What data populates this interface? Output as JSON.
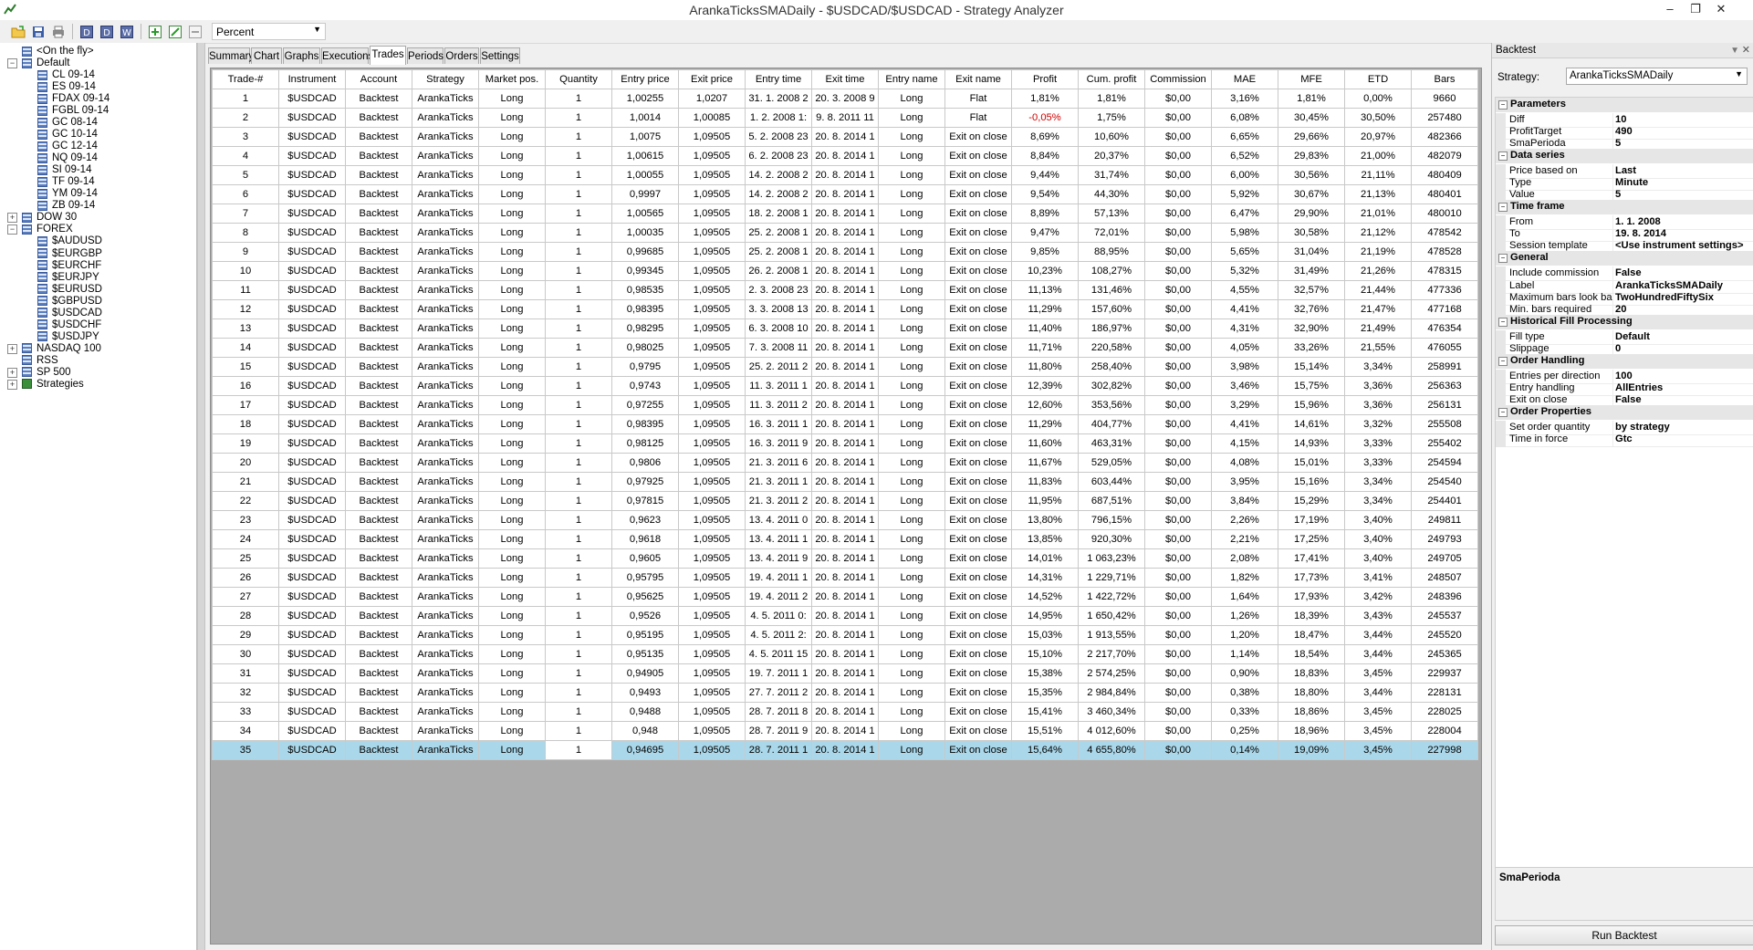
{
  "window": {
    "title": "ArankaTicksSMADaily - $USDCAD/$USDCAD - Strategy Analyzer"
  },
  "toolbar": {
    "display_mode": "Percent"
  },
  "tree": [
    {
      "label": "<On the fly>",
      "level": 1,
      "expander": "",
      "icon": "grid"
    },
    {
      "label": "Default",
      "level": 0,
      "expander": "−",
      "icon": "grid"
    },
    {
      "label": "CL 09-14",
      "level": 1,
      "expander": "",
      "icon": "instr"
    },
    {
      "label": "ES 09-14",
      "level": 1,
      "expander": "",
      "icon": "instr"
    },
    {
      "label": "FDAX 09-14",
      "level": 1,
      "expander": "",
      "icon": "instr"
    },
    {
      "label": "FGBL 09-14",
      "level": 1,
      "expander": "",
      "icon": "instr"
    },
    {
      "label": "GC 08-14",
      "level": 1,
      "expander": "",
      "icon": "instr"
    },
    {
      "label": "GC 10-14",
      "level": 1,
      "expander": "",
      "icon": "instr"
    },
    {
      "label": "GC 12-14",
      "level": 1,
      "expander": "",
      "icon": "instr"
    },
    {
      "label": "NQ 09-14",
      "level": 1,
      "expander": "",
      "icon": "instr"
    },
    {
      "label": "SI 09-14",
      "level": 1,
      "expander": "",
      "icon": "instr"
    },
    {
      "label": "TF 09-14",
      "level": 1,
      "expander": "",
      "icon": "instr"
    },
    {
      "label": "YM 09-14",
      "level": 1,
      "expander": "",
      "icon": "instr"
    },
    {
      "label": "ZB 09-14",
      "level": 1,
      "expander": "",
      "icon": "instr"
    },
    {
      "label": "DOW 30",
      "level": 0,
      "expander": "+",
      "icon": "grid"
    },
    {
      "label": "FOREX",
      "level": 0,
      "expander": "−",
      "icon": "grid"
    },
    {
      "label": "$AUDUSD",
      "level": 1,
      "expander": "",
      "icon": "instr"
    },
    {
      "label": "$EURGBP",
      "level": 1,
      "expander": "",
      "icon": "instr"
    },
    {
      "label": "$EURCHF",
      "level": 1,
      "expander": "",
      "icon": "instr"
    },
    {
      "label": "$EURJPY",
      "level": 1,
      "expander": "",
      "icon": "instr"
    },
    {
      "label": "$EURUSD",
      "level": 1,
      "expander": "",
      "icon": "instr"
    },
    {
      "label": "$GBPUSD",
      "level": 1,
      "expander": "",
      "icon": "instr"
    },
    {
      "label": "$USDCAD",
      "level": 1,
      "expander": "",
      "icon": "instr"
    },
    {
      "label": "$USDCHF",
      "level": 1,
      "expander": "",
      "icon": "instr"
    },
    {
      "label": "$USDJPY",
      "level": 1,
      "expander": "",
      "icon": "instr"
    },
    {
      "label": "NASDAQ 100",
      "level": 0,
      "expander": "+",
      "icon": "grid"
    },
    {
      "label": "RSS",
      "level": 0,
      "expander": "",
      "icon": "grid"
    },
    {
      "label": "SP 500",
      "level": 0,
      "expander": "+",
      "icon": "grid"
    },
    {
      "label": "Strategies",
      "level": 0,
      "expander": "+",
      "icon": "strat"
    }
  ],
  "tabs": [
    "Summary",
    "Chart",
    "Graphs",
    "Executions",
    "Trades",
    "Periods",
    "Orders",
    "Settings"
  ],
  "active_tab": "Trades",
  "trades": {
    "columns": [
      "Trade-#",
      "Instrument",
      "Account",
      "Strategy",
      "Market pos.",
      "Quantity",
      "Entry price",
      "Exit price",
      "Entry time",
      "Exit time",
      "Entry name",
      "Exit name",
      "Profit",
      "Cum. profit",
      "Commission",
      "MAE",
      "MFE",
      "ETD",
      "Bars"
    ],
    "rows": [
      [
        "1",
        "$USDCAD",
        "Backtest",
        "ArankaTicks",
        "Long",
        "1",
        "1,00255",
        "1,0207",
        "31. 1. 2008 2",
        "20. 3. 2008 9",
        "Long",
        "Flat",
        "1,81%",
        "1,81%",
        "$0,00",
        "3,16%",
        "1,81%",
        "0,00%",
        "9660"
      ],
      [
        "2",
        "$USDCAD",
        "Backtest",
        "ArankaTicks",
        "Long",
        "1",
        "1,0014",
        "1,00085",
        "1. 2. 2008 1:",
        "9. 8. 2011 11",
        "Long",
        "Flat",
        "-0,05%",
        "1,75%",
        "$0,00",
        "6,08%",
        "30,45%",
        "30,50%",
        "257480"
      ],
      [
        "3",
        "$USDCAD",
        "Backtest",
        "ArankaTicks",
        "Long",
        "1",
        "1,0075",
        "1,09505",
        "5. 2. 2008 23",
        "20. 8. 2014 1",
        "Long",
        "Exit on close",
        "8,69%",
        "10,60%",
        "$0,00",
        "6,65%",
        "29,66%",
        "20,97%",
        "482366"
      ],
      [
        "4",
        "$USDCAD",
        "Backtest",
        "ArankaTicks",
        "Long",
        "1",
        "1,00615",
        "1,09505",
        "6. 2. 2008 23",
        "20. 8. 2014 1",
        "Long",
        "Exit on close",
        "8,84%",
        "20,37%",
        "$0,00",
        "6,52%",
        "29,83%",
        "21,00%",
        "482079"
      ],
      [
        "5",
        "$USDCAD",
        "Backtest",
        "ArankaTicks",
        "Long",
        "1",
        "1,00055",
        "1,09505",
        "14. 2. 2008 2",
        "20. 8. 2014 1",
        "Long",
        "Exit on close",
        "9,44%",
        "31,74%",
        "$0,00",
        "6,00%",
        "30,56%",
        "21,11%",
        "480409"
      ],
      [
        "6",
        "$USDCAD",
        "Backtest",
        "ArankaTicks",
        "Long",
        "1",
        "0,9997",
        "1,09505",
        "14. 2. 2008 2",
        "20. 8. 2014 1",
        "Long",
        "Exit on close",
        "9,54%",
        "44,30%",
        "$0,00",
        "5,92%",
        "30,67%",
        "21,13%",
        "480401"
      ],
      [
        "7",
        "$USDCAD",
        "Backtest",
        "ArankaTicks",
        "Long",
        "1",
        "1,00565",
        "1,09505",
        "18. 2. 2008 1",
        "20. 8. 2014 1",
        "Long",
        "Exit on close",
        "8,89%",
        "57,13%",
        "$0,00",
        "6,47%",
        "29,90%",
        "21,01%",
        "480010"
      ],
      [
        "8",
        "$USDCAD",
        "Backtest",
        "ArankaTicks",
        "Long",
        "1",
        "1,00035",
        "1,09505",
        "25. 2. 2008 1",
        "20. 8. 2014 1",
        "Long",
        "Exit on close",
        "9,47%",
        "72,01%",
        "$0,00",
        "5,98%",
        "30,58%",
        "21,12%",
        "478542"
      ],
      [
        "9",
        "$USDCAD",
        "Backtest",
        "ArankaTicks",
        "Long",
        "1",
        "0,99685",
        "1,09505",
        "25. 2. 2008 1",
        "20. 8. 2014 1",
        "Long",
        "Exit on close",
        "9,85%",
        "88,95%",
        "$0,00",
        "5,65%",
        "31,04%",
        "21,19%",
        "478528"
      ],
      [
        "10",
        "$USDCAD",
        "Backtest",
        "ArankaTicks",
        "Long",
        "1",
        "0,99345",
        "1,09505",
        "26. 2. 2008 1",
        "20. 8. 2014 1",
        "Long",
        "Exit on close",
        "10,23%",
        "108,27%",
        "$0,00",
        "5,32%",
        "31,49%",
        "21,26%",
        "478315"
      ],
      [
        "11",
        "$USDCAD",
        "Backtest",
        "ArankaTicks",
        "Long",
        "1",
        "0,98535",
        "1,09505",
        "2. 3. 2008 23",
        "20. 8. 2014 1",
        "Long",
        "Exit on close",
        "11,13%",
        "131,46%",
        "$0,00",
        "4,55%",
        "32,57%",
        "21,44%",
        "477336"
      ],
      [
        "12",
        "$USDCAD",
        "Backtest",
        "ArankaTicks",
        "Long",
        "1",
        "0,98395",
        "1,09505",
        "3. 3. 2008 13",
        "20. 8. 2014 1",
        "Long",
        "Exit on close",
        "11,29%",
        "157,60%",
        "$0,00",
        "4,41%",
        "32,76%",
        "21,47%",
        "477168"
      ],
      [
        "13",
        "$USDCAD",
        "Backtest",
        "ArankaTicks",
        "Long",
        "1",
        "0,98295",
        "1,09505",
        "6. 3. 2008 10",
        "20. 8. 2014 1",
        "Long",
        "Exit on close",
        "11,40%",
        "186,97%",
        "$0,00",
        "4,31%",
        "32,90%",
        "21,49%",
        "476354"
      ],
      [
        "14",
        "$USDCAD",
        "Backtest",
        "ArankaTicks",
        "Long",
        "1",
        "0,98025",
        "1,09505",
        "7. 3. 2008 11",
        "20. 8. 2014 1",
        "Long",
        "Exit on close",
        "11,71%",
        "220,58%",
        "$0,00",
        "4,05%",
        "33,26%",
        "21,55%",
        "476055"
      ],
      [
        "15",
        "$USDCAD",
        "Backtest",
        "ArankaTicks",
        "Long",
        "1",
        "0,9795",
        "1,09505",
        "25. 2. 2011 2",
        "20. 8. 2014 1",
        "Long",
        "Exit on close",
        "11,80%",
        "258,40%",
        "$0,00",
        "3,98%",
        "15,14%",
        "3,34%",
        "258991"
      ],
      [
        "16",
        "$USDCAD",
        "Backtest",
        "ArankaTicks",
        "Long",
        "1",
        "0,9743",
        "1,09505",
        "11. 3. 2011 1",
        "20. 8. 2014 1",
        "Long",
        "Exit on close",
        "12,39%",
        "302,82%",
        "$0,00",
        "3,46%",
        "15,75%",
        "3,36%",
        "256363"
      ],
      [
        "17",
        "$USDCAD",
        "Backtest",
        "ArankaTicks",
        "Long",
        "1",
        "0,97255",
        "1,09505",
        "11. 3. 2011 2",
        "20. 8. 2014 1",
        "Long",
        "Exit on close",
        "12,60%",
        "353,56%",
        "$0,00",
        "3,29%",
        "15,96%",
        "3,36%",
        "256131"
      ],
      [
        "18",
        "$USDCAD",
        "Backtest",
        "ArankaTicks",
        "Long",
        "1",
        "0,98395",
        "1,09505",
        "16. 3. 2011 1",
        "20. 8. 2014 1",
        "Long",
        "Exit on close",
        "11,29%",
        "404,77%",
        "$0,00",
        "4,41%",
        "14,61%",
        "3,32%",
        "255508"
      ],
      [
        "19",
        "$USDCAD",
        "Backtest",
        "ArankaTicks",
        "Long",
        "1",
        "0,98125",
        "1,09505",
        "16. 3. 2011 9",
        "20. 8. 2014 1",
        "Long",
        "Exit on close",
        "11,60%",
        "463,31%",
        "$0,00",
        "4,15%",
        "14,93%",
        "3,33%",
        "255402"
      ],
      [
        "20",
        "$USDCAD",
        "Backtest",
        "ArankaTicks",
        "Long",
        "1",
        "0,9806",
        "1,09505",
        "21. 3. 2011 6",
        "20. 8. 2014 1",
        "Long",
        "Exit on close",
        "11,67%",
        "529,05%",
        "$0,00",
        "4,08%",
        "15,01%",
        "3,33%",
        "254594"
      ],
      [
        "21",
        "$USDCAD",
        "Backtest",
        "ArankaTicks",
        "Long",
        "1",
        "0,97925",
        "1,09505",
        "21. 3. 2011 1",
        "20. 8. 2014 1",
        "Long",
        "Exit on close",
        "11,83%",
        "603,44%",
        "$0,00",
        "3,95%",
        "15,16%",
        "3,34%",
        "254540"
      ],
      [
        "22",
        "$USDCAD",
        "Backtest",
        "ArankaTicks",
        "Long",
        "1",
        "0,97815",
        "1,09505",
        "21. 3. 2011 2",
        "20. 8. 2014 1",
        "Long",
        "Exit on close",
        "11,95%",
        "687,51%",
        "$0,00",
        "3,84%",
        "15,29%",
        "3,34%",
        "254401"
      ],
      [
        "23",
        "$USDCAD",
        "Backtest",
        "ArankaTicks",
        "Long",
        "1",
        "0,9623",
        "1,09505",
        "13. 4. 2011 0",
        "20. 8. 2014 1",
        "Long",
        "Exit on close",
        "13,80%",
        "796,15%",
        "$0,00",
        "2,26%",
        "17,19%",
        "3,40%",
        "249811"
      ],
      [
        "24",
        "$USDCAD",
        "Backtest",
        "ArankaTicks",
        "Long",
        "1",
        "0,9618",
        "1,09505",
        "13. 4. 2011 1",
        "20. 8. 2014 1",
        "Long",
        "Exit on close",
        "13,85%",
        "920,30%",
        "$0,00",
        "2,21%",
        "17,25%",
        "3,40%",
        "249793"
      ],
      [
        "25",
        "$USDCAD",
        "Backtest",
        "ArankaTicks",
        "Long",
        "1",
        "0,9605",
        "1,09505",
        "13. 4. 2011 9",
        "20. 8. 2014 1",
        "Long",
        "Exit on close",
        "14,01%",
        "1 063,23%",
        "$0,00",
        "2,08%",
        "17,41%",
        "3,40%",
        "249705"
      ],
      [
        "26",
        "$USDCAD",
        "Backtest",
        "ArankaTicks",
        "Long",
        "1",
        "0,95795",
        "1,09505",
        "19. 4. 2011 1",
        "20. 8. 2014 1",
        "Long",
        "Exit on close",
        "14,31%",
        "1 229,71%",
        "$0,00",
        "1,82%",
        "17,73%",
        "3,41%",
        "248507"
      ],
      [
        "27",
        "$USDCAD",
        "Backtest",
        "ArankaTicks",
        "Long",
        "1",
        "0,95625",
        "1,09505",
        "19. 4. 2011 2",
        "20. 8. 2014 1",
        "Long",
        "Exit on close",
        "14,52%",
        "1 422,72%",
        "$0,00",
        "1,64%",
        "17,93%",
        "3,42%",
        "248396"
      ],
      [
        "28",
        "$USDCAD",
        "Backtest",
        "ArankaTicks",
        "Long",
        "1",
        "0,9526",
        "1,09505",
        "4. 5. 2011 0:",
        "20. 8. 2014 1",
        "Long",
        "Exit on close",
        "14,95%",
        "1 650,42%",
        "$0,00",
        "1,26%",
        "18,39%",
        "3,43%",
        "245537"
      ],
      [
        "29",
        "$USDCAD",
        "Backtest",
        "ArankaTicks",
        "Long",
        "1",
        "0,95195",
        "1,09505",
        "4. 5. 2011 2:",
        "20. 8. 2014 1",
        "Long",
        "Exit on close",
        "15,03%",
        "1 913,55%",
        "$0,00",
        "1,20%",
        "18,47%",
        "3,44%",
        "245520"
      ],
      [
        "30",
        "$USDCAD",
        "Backtest",
        "ArankaTicks",
        "Long",
        "1",
        "0,95135",
        "1,09505",
        "4. 5. 2011 15",
        "20. 8. 2014 1",
        "Long",
        "Exit on close",
        "15,10%",
        "2 217,70%",
        "$0,00",
        "1,14%",
        "18,54%",
        "3,44%",
        "245365"
      ],
      [
        "31",
        "$USDCAD",
        "Backtest",
        "ArankaTicks",
        "Long",
        "1",
        "0,94905",
        "1,09505",
        "19. 7. 2011 1",
        "20. 8. 2014 1",
        "Long",
        "Exit on close",
        "15,38%",
        "2 574,25%",
        "$0,00",
        "0,90%",
        "18,83%",
        "3,45%",
        "229937"
      ],
      [
        "32",
        "$USDCAD",
        "Backtest",
        "ArankaTicks",
        "Long",
        "1",
        "0,9493",
        "1,09505",
        "27. 7. 2011 2",
        "20. 8. 2014 1",
        "Long",
        "Exit on close",
        "15,35%",
        "2 984,84%",
        "$0,00",
        "0,38%",
        "18,80%",
        "3,44%",
        "228131"
      ],
      [
        "33",
        "$USDCAD",
        "Backtest",
        "ArankaTicks",
        "Long",
        "1",
        "0,9488",
        "1,09505",
        "28. 7. 2011 8",
        "20. 8. 2014 1",
        "Long",
        "Exit on close",
        "15,41%",
        "3 460,34%",
        "$0,00",
        "0,33%",
        "18,86%",
        "3,45%",
        "228025"
      ],
      [
        "34",
        "$USDCAD",
        "Backtest",
        "ArankaTicks",
        "Long",
        "1",
        "0,948",
        "1,09505",
        "28. 7. 2011 9",
        "20. 8. 2014 1",
        "Long",
        "Exit on close",
        "15,51%",
        "4 012,60%",
        "$0,00",
        "0,25%",
        "18,96%",
        "3,45%",
        "228004"
      ],
      [
        "35",
        "$USDCAD",
        "Backtest",
        "ArankaTicks",
        "Long",
        "1",
        "0,94695",
        "1,09505",
        "28. 7. 2011 1",
        "20. 8. 2014 1",
        "Long",
        "Exit on close",
        "15,64%",
        "4 655,80%",
        "$0,00",
        "0,14%",
        "19,09%",
        "3,45%",
        "227998"
      ]
    ],
    "selected_row": 35,
    "negative_color": "#d00000",
    "selection_color": "#aad8ea"
  },
  "right_panel": {
    "header": "Backtest",
    "strategy_label": "Strategy:",
    "strategy_value": "ArankaTicksSMADaily",
    "properties": [
      {
        "type": "cat",
        "name": "Parameters"
      },
      {
        "type": "item",
        "name": "Diff",
        "value": "10"
      },
      {
        "type": "item",
        "name": "ProfitTarget",
        "value": "490"
      },
      {
        "type": "item",
        "name": "SmaPerioda",
        "value": "5"
      },
      {
        "type": "cat",
        "name": "Data series"
      },
      {
        "type": "item",
        "name": "Price based on",
        "value": "Last"
      },
      {
        "type": "item",
        "name": "Type",
        "value": "Minute"
      },
      {
        "type": "item",
        "name": "Value",
        "value": "5"
      },
      {
        "type": "cat",
        "name": "Time frame"
      },
      {
        "type": "item",
        "name": "From",
        "value": "1. 1. 2008"
      },
      {
        "type": "item",
        "name": "To",
        "value": "19. 8. 2014"
      },
      {
        "type": "item",
        "name": "Session template",
        "value": "<Use instrument settings>"
      },
      {
        "type": "cat",
        "name": "General"
      },
      {
        "type": "item",
        "name": "Include commission",
        "value": "False"
      },
      {
        "type": "item",
        "name": "Label",
        "value": "ArankaTicksSMADaily"
      },
      {
        "type": "item",
        "name": "Maximum bars look bac",
        "value": "TwoHundredFiftySix"
      },
      {
        "type": "item",
        "name": "Min. bars required",
        "value": "20"
      },
      {
        "type": "cat",
        "name": "Historical Fill Processing"
      },
      {
        "type": "item",
        "name": "Fill type",
        "value": "Default"
      },
      {
        "type": "item",
        "name": "Slippage",
        "value": "0"
      },
      {
        "type": "cat",
        "name": "Order Handling"
      },
      {
        "type": "item",
        "name": "Entries per direction",
        "value": "100"
      },
      {
        "type": "item",
        "name": "Entry handling",
        "value": "AllEntries"
      },
      {
        "type": "item",
        "name": "Exit on close",
        "value": "False"
      },
      {
        "type": "cat",
        "name": "Order Properties"
      },
      {
        "type": "item",
        "name": "Set order quantity",
        "value": "by strategy"
      },
      {
        "type": "item",
        "name": "Time in force",
        "value": "Gtc"
      }
    ],
    "description_title": "SmaPerioda",
    "run_button": "Run Backtest"
  }
}
